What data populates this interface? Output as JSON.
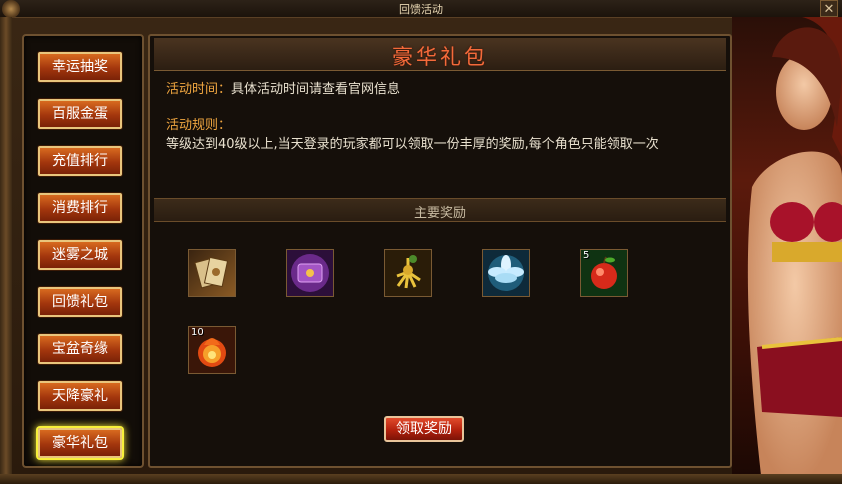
{
  "window": {
    "title": "回馈活动",
    "close_label": "✕"
  },
  "sidebar": {
    "items": [
      {
        "label": "幸运抽奖"
      },
      {
        "label": "百服金蛋"
      },
      {
        "label": "充值排行"
      },
      {
        "label": "消费排行"
      },
      {
        "label": "迷雾之城"
      },
      {
        "label": "回馈礼包"
      },
      {
        "label": "宝盆奇缘"
      },
      {
        "label": "天降豪礼"
      },
      {
        "label": "豪华礼包"
      }
    ],
    "active_index": 8
  },
  "main": {
    "title": "豪华礼包",
    "time_label": "活动时间：",
    "time_value": "具体活动时间请查看官网信息",
    "rules_label": "活动规则：",
    "rules_text": "等级达到40级以上,当天登录的玩家都可以领取一份丰厚的奖励,每个角色只能领取一次",
    "rewards_header": "主要奖励",
    "rewards": [
      {
        "icon": "cards-icon",
        "qty": ""
      },
      {
        "icon": "purple-scroll-icon",
        "qty": ""
      },
      {
        "icon": "ginseng-icon",
        "qty": ""
      },
      {
        "icon": "lotus-icon",
        "qty": ""
      },
      {
        "icon": "apple-icon",
        "qty": "5"
      },
      {
        "icon": "fireball-icon",
        "qty": "10"
      }
    ],
    "claim_label": "领取奖励"
  },
  "colors": {
    "accent_orange": "#f0a640",
    "title_red": "#f46a3a",
    "active_glow": "#f7f03a"
  }
}
